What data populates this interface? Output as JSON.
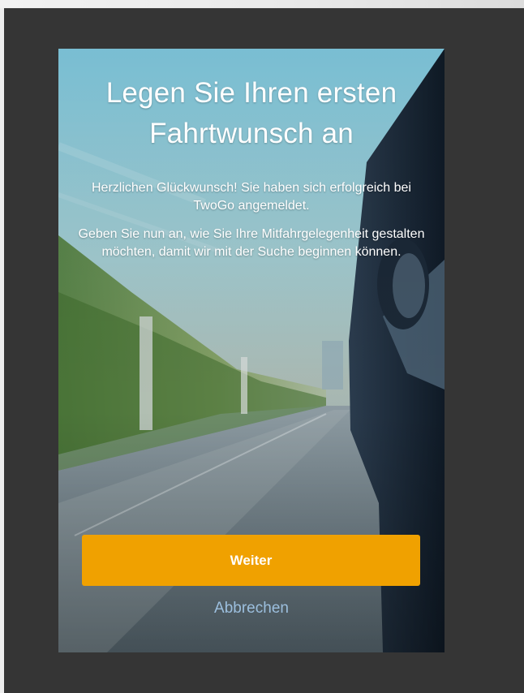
{
  "dialog": {
    "title": "Legen Sie Ihren ersten Fahrtwunsch an",
    "paragraph_1": "Herzlichen Glückwunsch! Sie haben sich erfolgreich bei TwoGo angemeldet.",
    "paragraph_2": "Geben Sie nun an, wie Sie Ihre Mitfahrgelegenheit gestalten möchten, damit wir mit der Suche beginnen können.",
    "primary_button_label": "Weiter",
    "secondary_button_label": "Abbrechen"
  },
  "colors": {
    "primary_button": "#f0a100",
    "secondary_link": "#9cbfde",
    "backdrop": "#353535"
  }
}
